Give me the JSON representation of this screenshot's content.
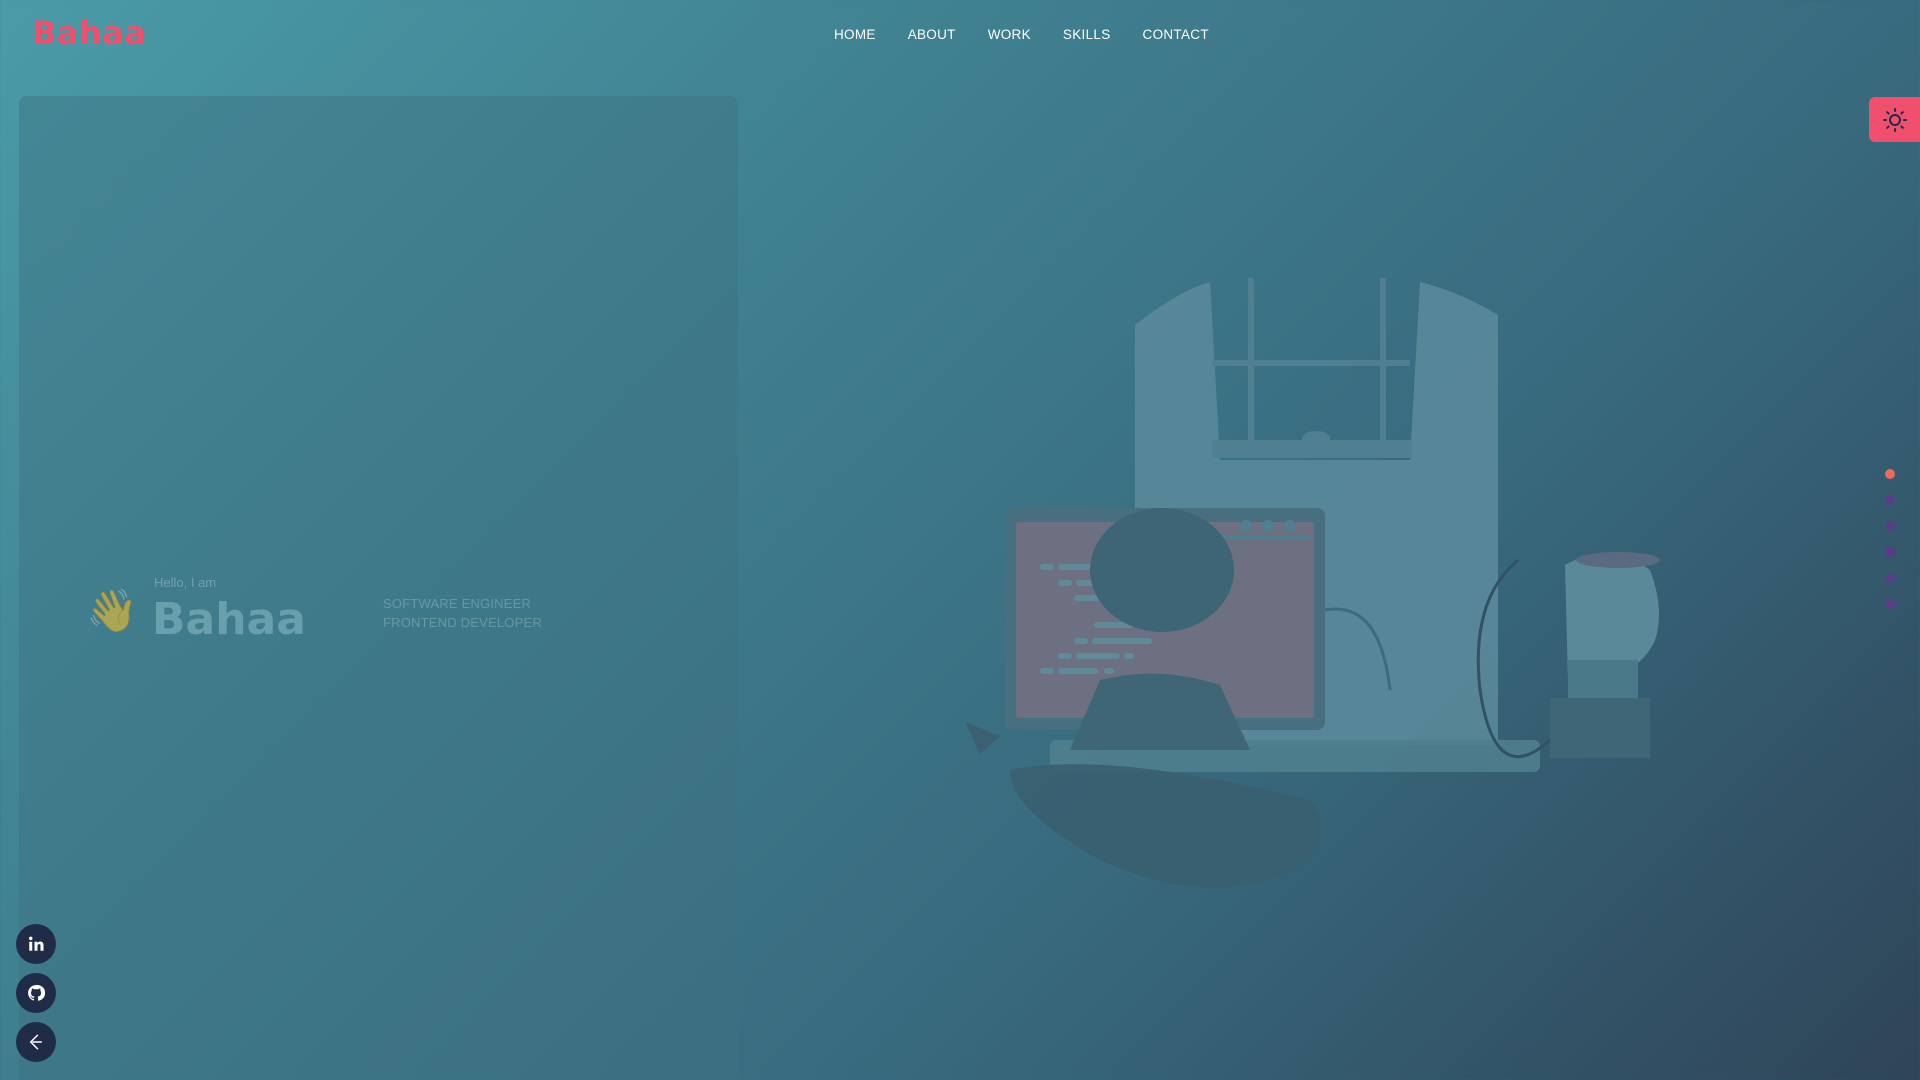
{
  "brand": {
    "logo_text": "Bahaa",
    "accent_color": "#f0506e"
  },
  "nav": {
    "items": [
      {
        "label": "HOME"
      },
      {
        "label": "ABOUT"
      },
      {
        "label": "WORK"
      },
      {
        "label": "SKILLS"
      },
      {
        "label": "CONTACT"
      }
    ]
  },
  "hero": {
    "wave_emoji": "👋",
    "greeting": "Hello, I am",
    "name": "Bahaa",
    "roles": [
      "SOFTWARE ENGINEER",
      "FRONTEND DEVELOPER"
    ]
  },
  "theme_toggle": {
    "icon": "sun-icon"
  },
  "section_dots": {
    "count": 6,
    "active_index": 0,
    "active_color": "#f06a5a",
    "inactive_color": "#5b3c8a"
  },
  "socials": [
    {
      "icon": "linkedin-icon",
      "glyph": "in"
    },
    {
      "icon": "github-icon"
    },
    {
      "icon": "codewars-icon"
    }
  ]
}
